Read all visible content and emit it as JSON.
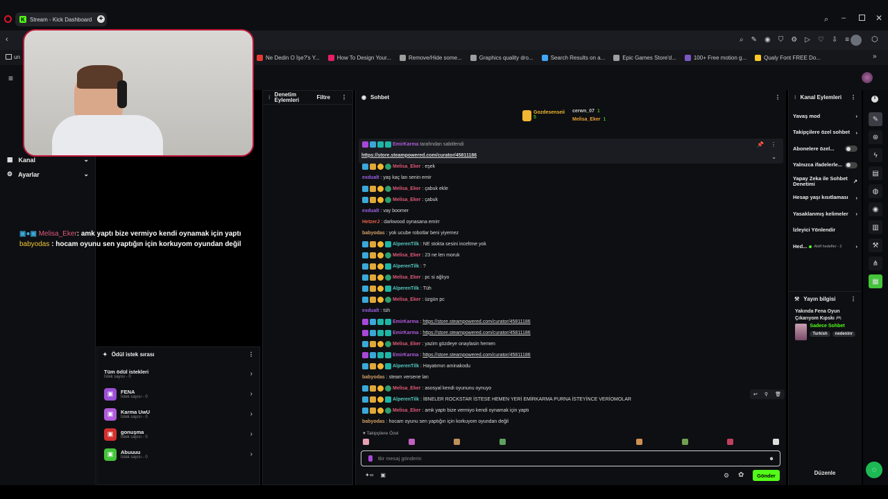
{
  "browser": {
    "tab_title": "Stream - Kick Dashboard",
    "new_tab": "+",
    "bookmarks": [
      {
        "label": "Ne Dedin O İşe?'s Y...",
        "color": "#e53935"
      },
      {
        "label": "How To Design Your...",
        "color": "#e91e63"
      },
      {
        "label": "Remove/Hide some...",
        "color": "#9e9e9e"
      },
      {
        "label": "Graphics quality dro...",
        "color": "#9e9e9e"
      },
      {
        "label": "Search Results on a...",
        "color": "#42a5f5"
      },
      {
        "label": "Epic Games Store'd...",
        "color": "#9e9e9e"
      },
      {
        "label": "100+ Free motion g...",
        "color": "#7e57c2"
      },
      {
        "label": "Qualy Font FREE Do...",
        "color": "#ffca28"
      }
    ],
    "bookmarks_first": "un"
  },
  "left_nav": {
    "items": [
      {
        "label": "Kanal",
        "icon": "channel-icon"
      },
      {
        "label": "Ayarlar",
        "icon": "gear-icon"
      }
    ]
  },
  "overlay_chat": [
    {
      "user": "Melisa_Eker",
      "text": ": amk yaptı bize vermiyo kendi oynamak için yaptı",
      "color": "#e05a7a"
    },
    {
      "user": "babyodas",
      "text": " : hocam oyunu sen yaptığın için korkuyom oyundan değil",
      "color": "#f2c832"
    }
  ],
  "moderation": {
    "title": "Denetim Eylemleri",
    "filter": "Filtre"
  },
  "rewards": {
    "title": "Ödül istek sırası",
    "all": {
      "label": "Tüm ödül istekleri",
      "count": "İstek sayısı - 0"
    },
    "items": [
      {
        "name": "FENA",
        "count": "İstek sayısı - 0",
        "color": "#9a4fd6"
      },
      {
        "name": "Karma UwU",
        "count": "İstek sayısı - 0",
        "color": "#b05adb"
      },
      {
        "name": "gonuşma",
        "count": "İstek sayısı - 0",
        "color": "#d32f2f"
      },
      {
        "name": "Abuuuu",
        "count": "İstek sayısı - 0",
        "color": "#43c43a"
      }
    ]
  },
  "chat": {
    "title": "Sohbet",
    "top_gifters": [
      {
        "name": "Gozdesenseii",
        "count": "5",
        "color": "#f2b632"
      },
      {
        "name": "cerwn_07",
        "count": "1",
        "color": "#cccccc"
      },
      {
        "name": "Melisa_Eker",
        "count": "1",
        "color": "#e8a23a"
      }
    ],
    "pinned": {
      "by_user": "EmirKarma",
      "by_text": "tarafından sabitlendi",
      "link": "https://store.steampowered.com/curator/45811186"
    },
    "messages": [
      {
        "user": "Melisa_Eker",
        "cls": "u1",
        "badges": [
          "b",
          "o",
          "y",
          "g"
        ],
        "text": ": eşek"
      },
      {
        "user": "exdualt",
        "cls": "u2",
        "badges": [],
        "text": ": yaş kaç lan senin emir"
      },
      {
        "user": "Melisa_Eker",
        "cls": "u1",
        "badges": [
          "b",
          "o",
          "y",
          "g"
        ],
        "text": ": çabuk ekle"
      },
      {
        "user": "Melisa_Eker",
        "cls": "u1",
        "badges": [
          "b",
          "o",
          "y",
          "g"
        ],
        "text": ": çabuk"
      },
      {
        "user": "exdualt",
        "cls": "u2",
        "badges": [],
        "text": ": vay boomer"
      },
      {
        "user": "HetzerJ",
        "cls": "u6",
        "badges": [],
        "text": ": darkwood oynasana emirr"
      },
      {
        "user": "babyodas",
        "cls": "u4",
        "badges": [],
        "text": ": yok ucube robotlar beni yiyemez"
      },
      {
        "user": "AlperenTilk",
        "cls": "u3",
        "badges": [
          "b",
          "o",
          "y",
          "t"
        ],
        "text": ": NE stokta sesini inceltme yok"
      },
      {
        "user": "Melisa_Eker",
        "cls": "u1",
        "badges": [
          "b",
          "o",
          "y",
          "g"
        ],
        "text": ": 23 ne len moruk"
      },
      {
        "user": "AlperenTilk",
        "cls": "u3",
        "badges": [
          "b",
          "o",
          "y",
          "t"
        ],
        "text": ": ?"
      },
      {
        "user": "Melisa_Eker",
        "cls": "u1",
        "badges": [
          "b",
          "o",
          "y",
          "g"
        ],
        "text": ": pc si ağlıyo"
      },
      {
        "user": "AlperenTilk",
        "cls": "u3",
        "badges": [
          "b",
          "o",
          "y",
          "t"
        ],
        "text": ": Tüh"
      },
      {
        "user": "Melisa_Eker",
        "cls": "u1",
        "badges": [
          "b",
          "o",
          "y",
          "g"
        ],
        "text": ": üzgün pc"
      },
      {
        "user": "exdualt",
        "cls": "u2",
        "badges": [],
        "text": ": tüh"
      },
      {
        "user": "EmirKarma",
        "cls": "u5",
        "badges": [
          "p",
          "b",
          "t",
          "t"
        ],
        "text": "https://store.steampowered.com/curator/45811186",
        "link": true
      },
      {
        "user": "EmirKarma",
        "cls": "u5",
        "badges": [
          "p",
          "b",
          "t",
          "t"
        ],
        "text": "https://store.steampowered.com/curator/45811186",
        "link": true
      },
      {
        "user": "Melisa_Eker",
        "cls": "u1",
        "badges": [
          "b",
          "o",
          "y",
          "g"
        ],
        "text": ": yazim gözdeye onaylasin hemen"
      },
      {
        "user": "EmirKarma",
        "cls": "u5",
        "badges": [
          "p",
          "b",
          "t",
          "t"
        ],
        "text": "https://store.steampowered.com/curator/45811186",
        "link": true
      },
      {
        "user": "AlperenTilk",
        "cls": "u3",
        "badges": [
          "b",
          "o",
          "y",
          "t"
        ],
        "text": ": Hayatımın aminakodu"
      },
      {
        "user": "babyodas",
        "cls": "u4",
        "badges": [],
        "text": ": steam versene lan"
      },
      {
        "user": "Melisa_Eker",
        "cls": "u1",
        "badges": [
          "b",
          "o",
          "y",
          "g"
        ],
        "text": ": asosyal kendi oyununu oynuyo"
      },
      {
        "user": "AlperenTilk",
        "cls": "u3",
        "badges": [
          "b",
          "o",
          "y",
          "t"
        ],
        "text": ": İBNELER ROCKSTAR İSTESE HEMEN YERİ EMİRKARMA PURNA İSTEYİNCE VERİOMOLAR"
      },
      {
        "user": "Melisa_Eker",
        "cls": "u1",
        "badges": [
          "b",
          "o",
          "y",
          "g"
        ],
        "text": ": amk yaptı bize vermiyo kendi oynamak için yaptı"
      },
      {
        "user": "babyodas",
        "cls": "u4",
        "badges": [],
        "text": ": hocam oyunu sen yaptığın için korkuyom oyundan değil"
      }
    ],
    "followers_only": "Takipçilere Özel",
    "input_placeholder": "Bir mesaj gönderin",
    "send": "Gönder"
  },
  "channel_actions": {
    "title": "Kanal Eylemleri",
    "options": [
      {
        "label": "Yavaş mod",
        "type": "arrow"
      },
      {
        "label": "Takipçilere özel sohbet",
        "type": "arrow"
      },
      {
        "label": "Abonelere özel...",
        "type": "toggle"
      },
      {
        "label": "Yalnızca ifadelerle...",
        "type": "toggle"
      },
      {
        "label": "Yapay Zeka ile Sohbet Denetimi",
        "type": "ext"
      },
      {
        "label": "Hesap yaşı kısıtlaması",
        "type": "arrow"
      },
      {
        "label": "Yasaklanmış kelimeler",
        "type": "arrow"
      },
      {
        "label": "İzleyici Yönlendir",
        "type": "none"
      }
    ],
    "goals": {
      "label": "Hed...",
      "sub": "Aktif hedefler - 2"
    }
  },
  "stream_info": {
    "title": "Yayın bilgisi",
    "stream_title": "Yakında Fena Oyun Çıkarıyom Kıpskı 🎮",
    "category": "Sadece Sohbet",
    "tags": [
      "Turkish",
      "nedeninr"
    ],
    "edit": "Düzenle"
  }
}
